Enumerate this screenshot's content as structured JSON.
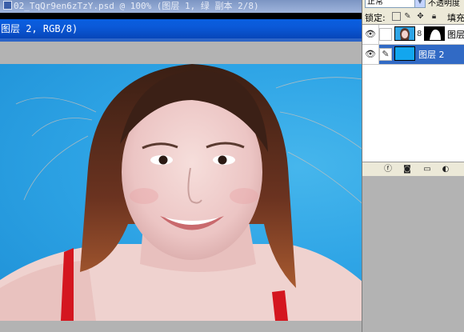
{
  "document": {
    "inactive_title": "02_TqQr9en6zTzY.psd @ 100% (图层 1, 绿 副本 2/8)",
    "active_title": "图层 2, RGB/8)"
  },
  "layers_panel": {
    "blend_mode": "正常",
    "opacity_label": "不透明度",
    "lock_label": "锁定:",
    "fill_label": "填充",
    "layers": [
      {
        "name": "图层",
        "selected": false,
        "has_mask": true,
        "thumb_type": "photo"
      },
      {
        "name": "图层 2",
        "selected": true,
        "has_mask": false,
        "thumb_type": "solid-blue"
      }
    ]
  },
  "colors": {
    "title_active": "#0a5fe0",
    "selection": "#316ac5",
    "sky_blue": "#1e90d6",
    "panel_bg": "#ece9d8"
  },
  "icons": {
    "visibility": "eye-icon",
    "lock_transparent": "lock-transparent-icon",
    "lock_paint": "lock-paint-icon",
    "lock_move": "lock-move-icon",
    "lock_all": "lock-all-icon",
    "chain": "chain-link-icon",
    "brush": "brush-icon"
  }
}
